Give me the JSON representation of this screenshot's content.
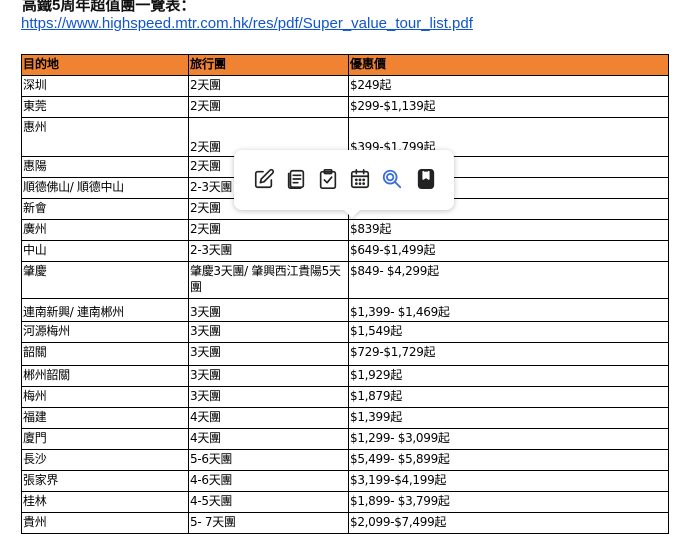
{
  "page": {
    "title": "高鐵5周年超值團一覽表：",
    "link": "https://www.highspeed.mtr.com.hk/res/pdf/Super_value_tour_list.pdf"
  },
  "colors": {
    "header_bg": "#ef8332",
    "link": "#1155cc",
    "search_icon": "#3b6fd6"
  },
  "table": {
    "headers": [
      "目的地",
      "旅行團",
      "優惠價"
    ],
    "rows": [
      [
        "深圳",
        "2天團",
        "$249起"
      ],
      [
        "東莞",
        "2天團",
        "$299-$1,139起"
      ],
      [
        "惠州",
        "2天團",
        "$399-$1,799起"
      ],
      [
        "惠陽",
        "2天團",
        ""
      ],
      [
        "順德佛山/ 順德中山",
        "2-3天團",
        ""
      ],
      [
        "新會",
        "2天團",
        ""
      ],
      [
        "廣州",
        "2天團",
        "$839起"
      ],
      [
        "中山",
        "2-3天團",
        "$649-$1,499起"
      ],
      [
        "肇慶",
        "肇慶3天團/ 肇興西江貴陽5天團",
        "$849- $4,299起"
      ],
      [
        "連南新興/ 連南郴州",
        "3天團",
        "$1,399- $1,469起"
      ],
      [
        "河源梅州",
        "3天團",
        "$1,549起"
      ],
      [
        "韶關",
        "3天團",
        "$729-$1,729起"
      ],
      [
        "郴州韶關",
        "3天團",
        "$1,929起"
      ],
      [
        "梅州",
        "3天團",
        "$1,879起"
      ],
      [
        "福建",
        "4天團",
        "$1,399起"
      ],
      [
        "廈門",
        "4天團",
        "$1,299- $3,099起"
      ],
      [
        "長沙",
        "5-6天團",
        "$5,499- $5,899起"
      ],
      [
        "張家界",
        "4-6天團",
        "$3,199-$4,199起"
      ],
      [
        "桂林",
        "4-5天團",
        "$1,899- $3,799起"
      ],
      [
        "貴州",
        "5- 7天團",
        "$2,099-$7,499起"
      ]
    ]
  },
  "toolbar": {
    "icons": [
      "edit-icon",
      "notes-icon",
      "clipboard-check-icon",
      "calendar-icon",
      "search-icon",
      "bookmark-icon"
    ]
  }
}
